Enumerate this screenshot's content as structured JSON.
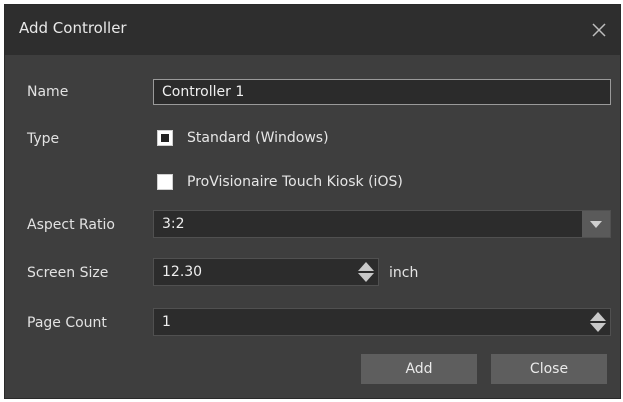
{
  "dialog": {
    "title": "Add Controller",
    "close_icon": "close-x-icon"
  },
  "form": {
    "name": {
      "label": "Name",
      "value": "Controller 1"
    },
    "type": {
      "label": "Type",
      "options": [
        {
          "label": "Standard (Windows)",
          "checked": true
        },
        {
          "label": "ProVisionaire Touch Kiosk (iOS)",
          "checked": false
        }
      ]
    },
    "aspect_ratio": {
      "label": "Aspect Ratio",
      "value": "3:2"
    },
    "screen_size": {
      "label": "Screen Size",
      "value": "12.30",
      "unit": "inch"
    },
    "page_count": {
      "label": "Page Count",
      "value": "1"
    }
  },
  "buttons": {
    "add": "Add",
    "close": "Close"
  },
  "colors": {
    "dialog_bg": "#3e3e3e",
    "titlebar_bg": "#2e2e2e",
    "field_bg": "#2c2c2c",
    "button_bg": "#5e5e5e",
    "text": "#e6e6e6"
  }
}
